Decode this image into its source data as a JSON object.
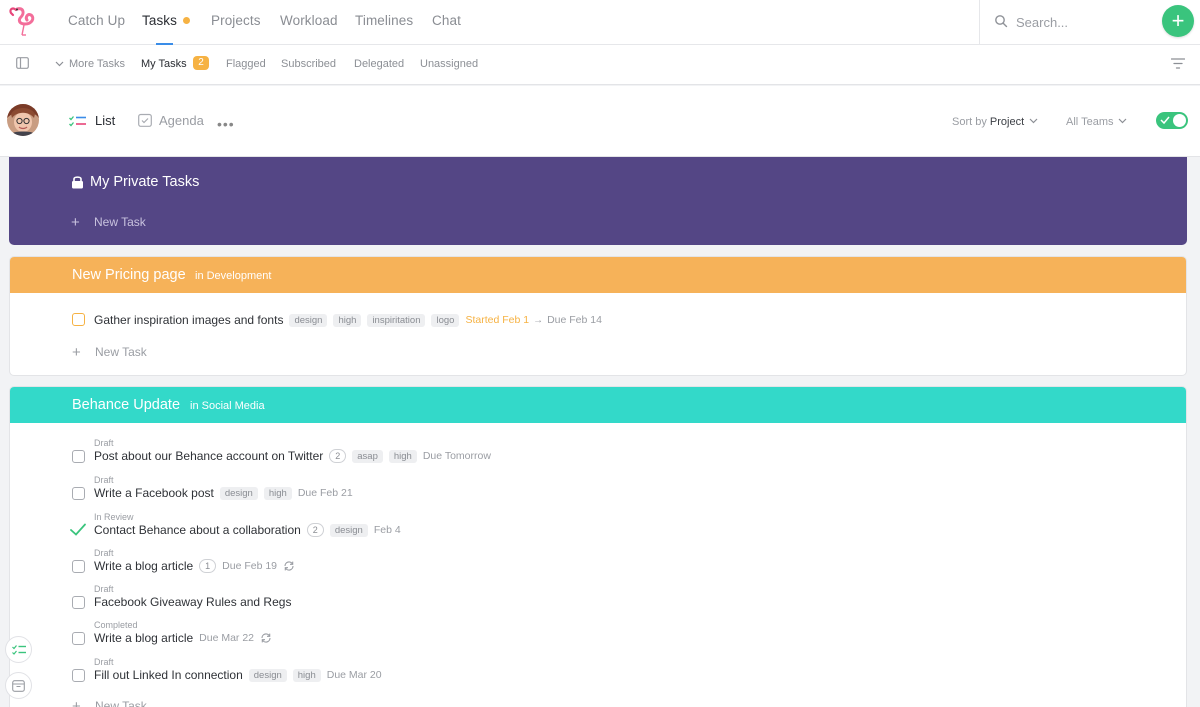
{
  "nav": {
    "items": [
      {
        "label": "Catch Up"
      },
      {
        "label": "Tasks"
      },
      {
        "label": "Projects"
      },
      {
        "label": "Workload"
      },
      {
        "label": "Timelines"
      },
      {
        "label": "Chat"
      }
    ],
    "search_placeholder": "Search...",
    "add_label": "+"
  },
  "subnav": {
    "more_tasks": "More Tasks",
    "my_tasks": "My Tasks",
    "my_tasks_count": "2",
    "flagged": "Flagged",
    "subscribed": "Subscribed",
    "delegated": "Delegated",
    "unassigned": "Unassigned"
  },
  "viewbar": {
    "list": "List",
    "agenda": "Agenda",
    "more": "•••",
    "sort_prefix": "Sort by",
    "sort_value": "Project",
    "teams": "All Teams"
  },
  "colors": {
    "private": "#544685",
    "pricing": "#f6b259",
    "behance": "#33d9c9",
    "accent": "#3ac47d"
  },
  "private": {
    "title": "My Private Tasks",
    "new_task": "New Task"
  },
  "pricing": {
    "title": "New Pricing page",
    "subtitle": "in Development",
    "tasks": [
      {
        "title": "Gather inspiration images and fonts",
        "tags": [
          "design",
          "high",
          "inspiritation",
          "logo"
        ],
        "started": "Started Feb 1",
        "arrow": "→",
        "due": "Due Feb 14"
      }
    ],
    "new_task": "New Task"
  },
  "behance": {
    "title": "Behance Update",
    "subtitle": "in Social Media",
    "tasks": [
      {
        "status": "Draft",
        "title": "Post about our Behance account on Twitter",
        "count": "2",
        "tags": [
          "asap",
          "high"
        ],
        "due": "Due Tomorrow"
      },
      {
        "status": "Draft",
        "title": "Write a Facebook post",
        "tags": [
          "design",
          "high"
        ],
        "due": "Due Feb 21"
      },
      {
        "status": "In Review",
        "title": "Contact Behance about a collaboration",
        "count": "2",
        "tags": [
          "design"
        ],
        "due": "Feb 4"
      },
      {
        "status": "Draft",
        "title": "Write a blog article",
        "count": "1",
        "due": "Due Feb 19"
      },
      {
        "status": "Draft",
        "title": "Facebook Giveaway Rules and Regs"
      },
      {
        "status": "Completed",
        "title": "Write a blog article",
        "due": "Due Mar 22"
      },
      {
        "status": "Draft",
        "title": "Fill out Linked In connection",
        "tags": [
          "design",
          "high"
        ],
        "due": "Due Mar 20"
      }
    ],
    "new_task": "New Task"
  }
}
